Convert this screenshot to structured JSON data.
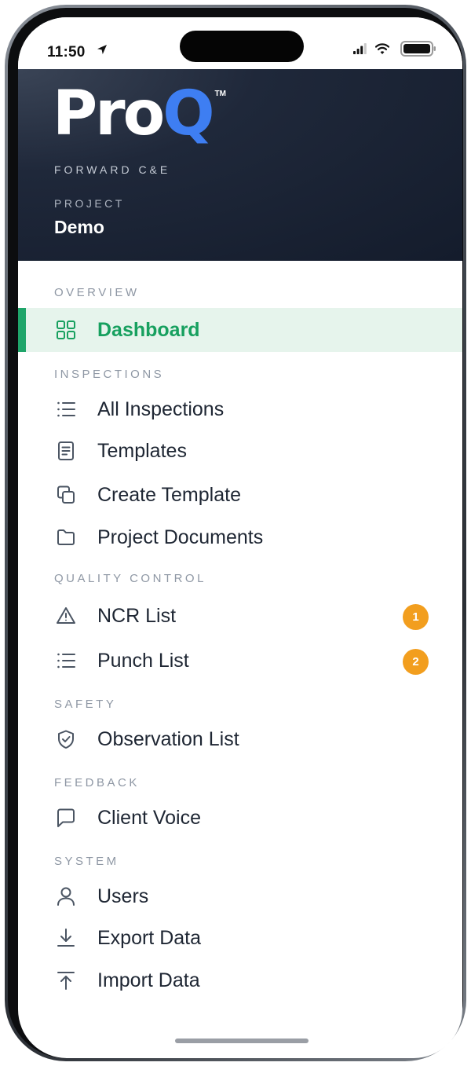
{
  "status_bar": {
    "time": "11:50",
    "icons": [
      "location-arrow-icon",
      "signal-icon",
      "wifi-icon",
      "battery-icon"
    ]
  },
  "brand": {
    "logo_pro": "Pro",
    "logo_q": "Q",
    "logo_tm": "TM",
    "company": "FORWARD C&E",
    "accent_color": "#3e7ef2"
  },
  "project": {
    "label": "PROJECT",
    "name": "Demo"
  },
  "sections": {
    "overview": "OVERVIEW",
    "inspections": "INSPECTIONS",
    "quality_control": "QUALITY CONTROL",
    "safety": "SAFETY",
    "feedback": "FEEDBACK",
    "system": "SYSTEM"
  },
  "items": {
    "dashboard": {
      "label": "Dashboard",
      "icon": "grid-icon",
      "active": true
    },
    "all_inspections": {
      "label": "All Inspections",
      "icon": "list-icon"
    },
    "templates": {
      "label": "Templates",
      "icon": "document-icon"
    },
    "create_template": {
      "label": "Create Template",
      "icon": "copy-icon"
    },
    "project_documents": {
      "label": "Project Documents",
      "icon": "folder-icon"
    },
    "ncr_list": {
      "label": "NCR List",
      "icon": "warning-icon",
      "badge": "1"
    },
    "punch_list": {
      "label": "Punch List",
      "icon": "list-icon",
      "badge": "2"
    },
    "observation_list": {
      "label": "Observation List",
      "icon": "shield-check-icon"
    },
    "client_voice": {
      "label": "Client Voice",
      "icon": "chat-bubble-icon"
    },
    "users": {
      "label": "Users",
      "icon": "user-icon"
    },
    "export_data": {
      "label": "Export Data",
      "icon": "download-icon"
    },
    "import_data": {
      "label": "Import Data",
      "icon": "upload-icon"
    }
  },
  "colors": {
    "active": "#17a05f",
    "active_bg": "#e6f4ec",
    "badge": "#f29e1e",
    "header_bg": "#141c2c"
  }
}
